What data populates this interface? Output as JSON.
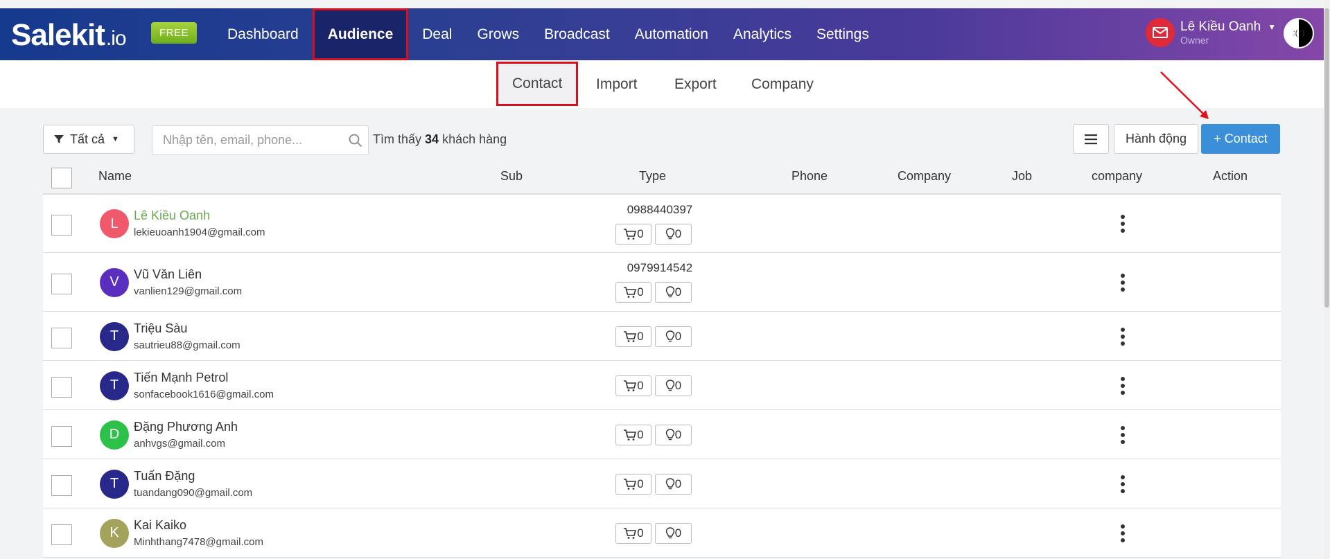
{
  "brand": {
    "logo_main": "Salekit",
    "logo_suffix": ".io",
    "badge": "FREE"
  },
  "nav": [
    "Dashboard",
    "Audience",
    "Deal",
    "Grows",
    "Broadcast",
    "Automation",
    "Analytics",
    "Settings"
  ],
  "nav_active": "Audience",
  "user": {
    "name": "Lê Kiều Oanh",
    "role": "Owner",
    "avatar_glyphs": ":( :)"
  },
  "subnav": [
    "Contact",
    "Import",
    "Export",
    "Company"
  ],
  "subnav_active": "Contact",
  "toolbar": {
    "filter_label": "Tất cả",
    "search_placeholder": "Nhập tên, email, phone...",
    "found_prefix": "Tìm thấy",
    "found_count": "34",
    "found_suffix": "khách hàng",
    "action_label": "Hành động",
    "add_label": "+ Contact"
  },
  "table": {
    "headers": [
      "Name",
      "Sub",
      "Type",
      "Phone",
      "Company",
      "Job",
      "company",
      "Action"
    ],
    "rows": [
      {
        "initial": "L",
        "color": "#f0596c",
        "name": "Lê Kiều Oanh",
        "email": "lekieuoanh1904@gmail.com",
        "phone": "0988440397",
        "orders": "0",
        "deals": "0",
        "highlight": true
      },
      {
        "initial": "V",
        "color": "#5a2fc0",
        "name": "Vũ Văn Liên",
        "email": "vanlien129@gmail.com",
        "phone": "0979914542",
        "orders": "0",
        "deals": "0",
        "highlight": false
      },
      {
        "initial": "T",
        "color": "#28288a",
        "name": "Triệu Sàu",
        "email": "sautrieu88@gmail.com",
        "phone": "",
        "orders": "0",
        "deals": "0",
        "highlight": false
      },
      {
        "initial": "T",
        "color": "#28288a",
        "name": "Tiến Mạnh Petrol",
        "email": "sonfacebook1616@gmail.com",
        "phone": "",
        "orders": "0",
        "deals": "0",
        "highlight": false
      },
      {
        "initial": "D",
        "color": "#2ec14a",
        "name": "Đặng Phương Anh",
        "email": "anhvgs@gmail.com",
        "phone": "",
        "orders": "0",
        "deals": "0",
        "highlight": false
      },
      {
        "initial": "T",
        "color": "#28288a",
        "name": "Tuấn Đặng",
        "email": "tuandang090@gmail.com",
        "phone": "",
        "orders": "0",
        "deals": "0",
        "highlight": false
      },
      {
        "initial": "K",
        "color": "#a3a35c",
        "name": "Kai Kaiko",
        "email": "Minhthang7478@gmail.com",
        "phone": "",
        "orders": "0",
        "deals": "0",
        "highlight": false
      }
    ]
  },
  "colors": {
    "accent": "#3b8ed8",
    "highlight_border": "#d8101c",
    "nav_active_bg": "#1a2468"
  },
  "icons": {
    "filter": "funnel-icon",
    "search": "magnifier-icon",
    "menu": "hamburger-icon",
    "mail": "envelope-icon",
    "cart": "cart-icon",
    "deal": "lightbulb-icon",
    "more": "kebab-icon"
  }
}
